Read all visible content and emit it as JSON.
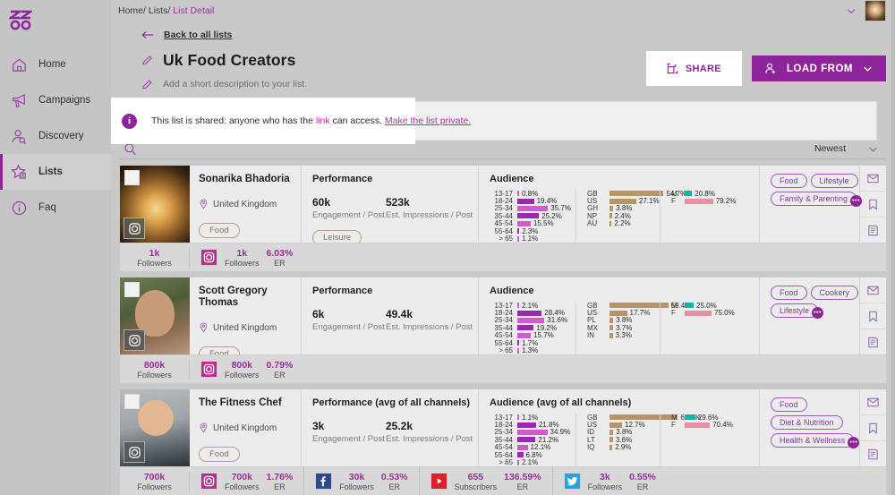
{
  "brand": {
    "accent": "#8e2499",
    "link": "#b5309f",
    "tag_border": "#b9a07f",
    "age_bar_dark": "#9c27b0",
    "age_bar_light": "#cc5ec9",
    "country_bar": "#b8946a",
    "male_bar": "#12b5a5",
    "female_bar": "#ea8ea3"
  },
  "sidebar": {
    "logo": "zoo-logo",
    "items": [
      {
        "label": "Home",
        "icon": "home-icon",
        "active": false
      },
      {
        "label": "Campaigns",
        "icon": "megaphone-icon",
        "active": false
      },
      {
        "label": "Discovery",
        "icon": "person-search-icon",
        "active": false
      },
      {
        "label": "Lists",
        "icon": "star-list-icon",
        "active": true
      },
      {
        "label": "Faq",
        "icon": "info-circle-icon",
        "active": false
      }
    ]
  },
  "topbar": {
    "breadcrumb": [
      "Home/",
      " Lists/",
      " List Detail"
    ],
    "chevron_icon": "chevron-down-icon",
    "avatar_icon": "user-avatar"
  },
  "pagehead": {
    "back_label": "Back to all lists",
    "back_icon": "arrow-left-icon",
    "title": "Uk Food Creators",
    "title_edit_icon": "pencil-icon",
    "description_placeholder": "Add a short description to your list.",
    "description_edit_icon": "pencil-icon",
    "share_label": "SHARE",
    "share_icon": "share-icon",
    "load_from_label": "LOAD FROM",
    "load_from_icon": "add-person-icon",
    "load_from_chevron": "chevron-down-icon"
  },
  "banner": {
    "icon": "info-icon",
    "text_before": "This list is shared: anyone who has the ",
    "link_text": "link",
    "text_middle": " can access. ",
    "action_text": "Make the list private."
  },
  "toolbar": {
    "search_icon": "search-icon",
    "sort_label": "Newest",
    "sort_chevron": "chevron-down-icon"
  },
  "cards": [
    {
      "thumb_class": "t0",
      "name": "Sonarika Bhadoria",
      "location": "United Kingdom",
      "category_tag": "Food",
      "performance_title": "Performance",
      "engagement_value": "60k",
      "engagement_caption": "Engagement / Post",
      "impressions_value": "523k",
      "impressions_caption": "Est. Impressions / Post",
      "interest_pill": "Leisure",
      "audience_title": "Audience",
      "age": [
        {
          "label": "13-17",
          "value": "0.8%",
          "pct": 0.8
        },
        {
          "label": "18-24",
          "value": "19.4%",
          "pct": 19.4
        },
        {
          "label": "25-34",
          "value": "35.7%",
          "pct": 35.7
        },
        {
          "label": "35-44",
          "value": "25.2%",
          "pct": 25.2
        },
        {
          "label": "45-54",
          "value": "15.5%",
          "pct": 15.5
        },
        {
          "label": "55-64",
          "value": "2.3%",
          "pct": 2.3
        },
        {
          "label": "> 65",
          "value": "1.1%",
          "pct": 1.1
        }
      ],
      "countries": [
        {
          "label": "GB",
          "value": "54.7%",
          "pct": 54.7
        },
        {
          "label": "US",
          "value": "27.1%",
          "pct": 27.1
        },
        {
          "label": "GH",
          "value": "3.8%",
          "pct": 3.8
        },
        {
          "label": "NP",
          "value": "2.4%",
          "pct": 2.4
        },
        {
          "label": "AU",
          "value": "2.2%",
          "pct": 2.2
        }
      ],
      "gender": [
        {
          "label": "M",
          "value": "20.8%",
          "pct": 20.8
        },
        {
          "label": "F",
          "value": "79.2%",
          "pct": 79.2
        }
      ],
      "tags_row1": [
        "Food",
        "Lifestyle"
      ],
      "tags_row2": [
        "Family & Parenting"
      ],
      "more_badge": "...",
      "actions": [
        "message-icon",
        "bookmark-icon",
        "note-icon"
      ],
      "total_followers": "1k",
      "total_caption": "Followers",
      "socials": [
        {
          "network": "instagram-icon",
          "value": "1k",
          "caption": "Followers",
          "er": "6.03%",
          "er_caption": "ER"
        }
      ]
    },
    {
      "thumb_class": "t1",
      "name": "Scott Gregory Thomas",
      "location": "United Kingdom",
      "category_tag": "Food",
      "performance_title": "Performance",
      "engagement_value": "6k",
      "engagement_caption": "Engagement / Post",
      "impressions_value": "49.4k",
      "impressions_caption": "Est. Impressions / Post",
      "interest_pill": "",
      "audience_title": "Audience",
      "age": [
        {
          "label": "13-17",
          "value": "2.1%",
          "pct": 2.1
        },
        {
          "label": "18-24",
          "value": "28.4%",
          "pct": 28.4
        },
        {
          "label": "25-34",
          "value": "31.6%",
          "pct": 31.6
        },
        {
          "label": "35-44",
          "value": "19.2%",
          "pct": 19.2
        },
        {
          "label": "45-54",
          "value": "15.7%",
          "pct": 15.7
        },
        {
          "label": "55-64",
          "value": "1.7%",
          "pct": 1.7
        },
        {
          "label": "> 65",
          "value": "1.3%",
          "pct": 1.3
        }
      ],
      "countries": [
        {
          "label": "GB",
          "value": "59.4%",
          "pct": 59.4
        },
        {
          "label": "US",
          "value": "17.7%",
          "pct": 17.7
        },
        {
          "label": "PL",
          "value": "3.8%",
          "pct": 3.8
        },
        {
          "label": "MX",
          "value": "3.7%",
          "pct": 3.7
        },
        {
          "label": "IN",
          "value": "3.3%",
          "pct": 3.3
        }
      ],
      "gender": [
        {
          "label": "M",
          "value": "25.0%",
          "pct": 25.0
        },
        {
          "label": "F",
          "value": "75.0%",
          "pct": 75.0
        }
      ],
      "tags_row1": [
        "Food",
        "Cookery"
      ],
      "tags_row2": [
        "Lifestyle"
      ],
      "more_badge": "...",
      "actions": [
        "message-icon",
        "bookmark-icon",
        "note-icon"
      ],
      "total_followers": "800k",
      "total_caption": "Followers",
      "socials": [
        {
          "network": "instagram-icon",
          "value": "800k",
          "caption": "Followers",
          "er": "0.79%",
          "er_caption": "ER"
        }
      ]
    },
    {
      "thumb_class": "t2",
      "name": "The Fitness Chef",
      "location": "United Kingdom",
      "category_tag": "Food",
      "performance_title": "Performance (avg of all channels)",
      "engagement_value": "3k",
      "engagement_caption": "Engagement / Post",
      "impressions_value": "25.2k",
      "impressions_caption": "Est. Impressions / Post",
      "interest_pill": "",
      "audience_title": "Audience (avg of all channels)",
      "age": [
        {
          "label": "13-17",
          "value": "1.1%",
          "pct": 1.1
        },
        {
          "label": "18-24",
          "value": "21.8%",
          "pct": 21.8
        },
        {
          "label": "25-34",
          "value": "34.9%",
          "pct": 34.9
        },
        {
          "label": "35-44",
          "value": "21.2%",
          "pct": 21.2
        },
        {
          "label": "45-54",
          "value": "12.1%",
          "pct": 12.1
        },
        {
          "label": "55-64",
          "value": "6.8%",
          "pct": 6.8
        },
        {
          "label": "> 65",
          "value": "2.1%",
          "pct": 2.1
        }
      ],
      "countries": [
        {
          "label": "GB",
          "value": "69.2%",
          "pct": 69.2
        },
        {
          "label": "US",
          "value": "12.7%",
          "pct": 12.7
        },
        {
          "label": "ID",
          "value": "3.8%",
          "pct": 3.8
        },
        {
          "label": "LT",
          "value": "3.6%",
          "pct": 3.6
        },
        {
          "label": "IQ",
          "value": "2.9%",
          "pct": 2.9
        }
      ],
      "gender": [
        {
          "label": "M",
          "value": "29.6%",
          "pct": 29.6
        },
        {
          "label": "F",
          "value": "70.4%",
          "pct": 70.4
        }
      ],
      "tags_row1": [
        "Food"
      ],
      "tags_row2": [
        "Diet & Nutrition"
      ],
      "tags_row3": [
        "Health & Wellness"
      ],
      "more_badge": "...",
      "actions": [
        "message-icon",
        "bookmark-icon",
        "note-icon"
      ],
      "total_followers": "700k",
      "total_caption": "Followers",
      "socials": [
        {
          "network": "instagram-icon",
          "value": "700k",
          "caption": "Followers",
          "er": "1.76%",
          "er_caption": "ER"
        },
        {
          "network": "facebook-icon",
          "value": "30k",
          "caption": "Followers",
          "er": "0.53%",
          "er_caption": "ER"
        },
        {
          "network": "youtube-icon",
          "value": "655",
          "caption": "Subscribers",
          "er": "136.59%",
          "er_caption": "ER"
        },
        {
          "network": "twitter-icon",
          "value": "3k",
          "caption": "Followers",
          "er": "0.55%",
          "er_caption": "ER"
        }
      ]
    }
  ]
}
